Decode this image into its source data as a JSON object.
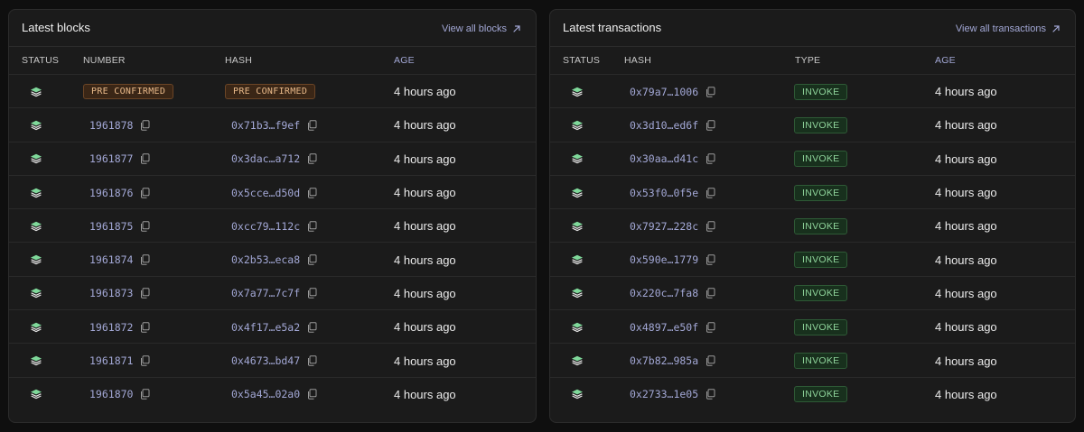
{
  "blocks_panel": {
    "title": "Latest blocks",
    "view_all_label": "View all blocks",
    "columns": {
      "status": "STATUS",
      "number": "NUMBER",
      "hash": "HASH",
      "age": "AGE"
    },
    "rows": [
      {
        "number": "PRE CONFIRMED",
        "hash": "PRE CONFIRMED",
        "age": "4 hours ago",
        "pending": true
      },
      {
        "number": "1961878",
        "hash": "0x71b3…f9ef",
        "age": "4 hours ago"
      },
      {
        "number": "1961877",
        "hash": "0x3dac…a712",
        "age": "4 hours ago"
      },
      {
        "number": "1961876",
        "hash": "0x5cce…d50d",
        "age": "4 hours ago"
      },
      {
        "number": "1961875",
        "hash": "0xcc79…112c",
        "age": "4 hours ago"
      },
      {
        "number": "1961874",
        "hash": "0x2b53…eca8",
        "age": "4 hours ago"
      },
      {
        "number": "1961873",
        "hash": "0x7a77…7c7f",
        "age": "4 hours ago"
      },
      {
        "number": "1961872",
        "hash": "0x4f17…e5a2",
        "age": "4 hours ago"
      },
      {
        "number": "1961871",
        "hash": "0x4673…bd47",
        "age": "4 hours ago"
      },
      {
        "number": "1961870",
        "hash": "0x5a45…02a0",
        "age": "4 hours ago"
      }
    ]
  },
  "transactions_panel": {
    "title": "Latest transactions",
    "view_all_label": "View all transactions",
    "columns": {
      "status": "STATUS",
      "hash": "HASH",
      "type": "TYPE",
      "age": "AGE"
    },
    "rows": [
      {
        "hash": "0x79a7…1006",
        "type": "INVOKE",
        "age": "4 hours ago"
      },
      {
        "hash": "0x3d10…ed6f",
        "type": "INVOKE",
        "age": "4 hours ago"
      },
      {
        "hash": "0x30aa…d41c",
        "type": "INVOKE",
        "age": "4 hours ago"
      },
      {
        "hash": "0x53f0…0f5e",
        "type": "INVOKE",
        "age": "4 hours ago"
      },
      {
        "hash": "0x7927…228c",
        "type": "INVOKE",
        "age": "4 hours ago"
      },
      {
        "hash": "0x590e…1779",
        "type": "INVOKE",
        "age": "4 hours ago"
      },
      {
        "hash": "0x220c…7fa8",
        "type": "INVOKE",
        "age": "4 hours ago"
      },
      {
        "hash": "0x4897…e50f",
        "type": "INVOKE",
        "age": "4 hours ago"
      },
      {
        "hash": "0x7b82…985a",
        "type": "INVOKE",
        "age": "4 hours ago"
      },
      {
        "hash": "0x2733…1e05",
        "type": "INVOKE",
        "age": "4 hours ago"
      }
    ]
  },
  "icons": {
    "status": "stack-layers-icon",
    "copy": "copy-icon",
    "external": "arrow-up-right-icon"
  },
  "colors": {
    "link": "#a3a8d6",
    "pre_confirmed": "#e8b989",
    "invoke": "#8fd49b",
    "status_icon": "#7fd89a"
  }
}
